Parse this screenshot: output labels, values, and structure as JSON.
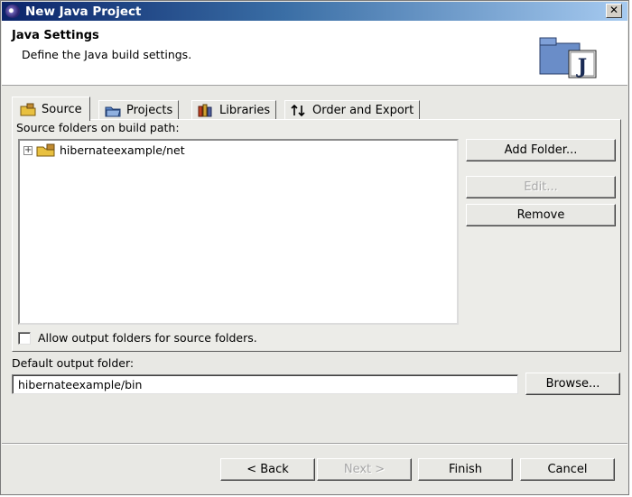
{
  "window": {
    "title": "New Java Project",
    "close_glyph": "✕"
  },
  "banner": {
    "title": "Java Settings",
    "description": "Define the Java build settings.",
    "icon": "java-project-icon"
  },
  "tabs": [
    {
      "label": "Source",
      "icon": "source-folder-icon",
      "active": true
    },
    {
      "label": "Projects",
      "icon": "project-folder-icon",
      "active": false
    },
    {
      "label": "Libraries",
      "icon": "libraries-icon",
      "active": false
    },
    {
      "label": "Order and Export",
      "icon": "sort-arrows-icon",
      "active": false
    }
  ],
  "source": {
    "folders_label": "Source folders on build path:",
    "tree": [
      {
        "label": "hibernateexample/net",
        "expanded": false,
        "icon": "package-folder-icon"
      }
    ],
    "buttons": {
      "add_folder": "Add Folder...",
      "edit": "Edit...",
      "remove": "Remove"
    },
    "allow_output_label": "Allow output folders for source folders.",
    "allow_output_checked": false
  },
  "output": {
    "label": "Default output folder:",
    "value": "hibernateexample/bin",
    "browse": "Browse..."
  },
  "footer": {
    "back": "< Back",
    "next": "Next >",
    "finish": "Finish",
    "cancel": "Cancel"
  },
  "colors": {
    "title_bar": "#0b246a",
    "dialog_bg": "#e8e8e4",
    "banner_bg": "#ffffff"
  }
}
